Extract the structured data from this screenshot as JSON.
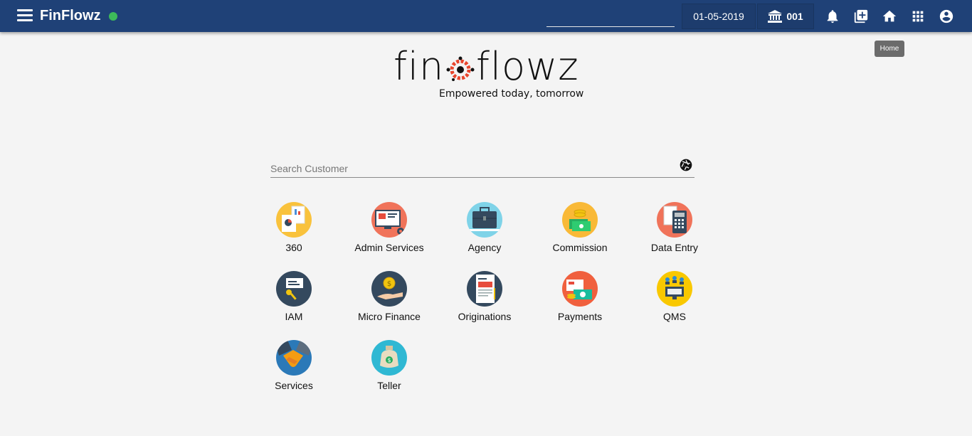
{
  "header": {
    "app_title": "FinFlowz",
    "date": "01-05-2019",
    "branch": "001",
    "search_value": "",
    "tooltip": "Home"
  },
  "logo": {
    "left": "fin",
    "right": "flowz",
    "tagline": "Empowered today, tomorrow"
  },
  "search": {
    "placeholder": "Search Customer"
  },
  "modules": [
    {
      "label": "360",
      "color": "#f9c23c"
    },
    {
      "label": "Admin Services",
      "color": "#f0735a"
    },
    {
      "label": "Agency",
      "color": "#7fd3e8"
    },
    {
      "label": "Commission",
      "color": "#f9b937"
    },
    {
      "label": "Data Entry",
      "color": "#f0735a"
    },
    {
      "label": "IAM",
      "color": "#34495e"
    },
    {
      "label": "Micro Finance",
      "color": "#34495e"
    },
    {
      "label": "Originations",
      "color": "#34495e"
    },
    {
      "label": "Payments",
      "color": "#f0603e"
    },
    {
      "label": "QMS",
      "color": "#f9c800"
    },
    {
      "label": "Services",
      "color": "#2b79b8"
    },
    {
      "label": "Teller",
      "color": "#2fb8d3"
    }
  ],
  "colors": {
    "topbar": "#1f4177",
    "status": "#3dba5a",
    "background": "#f4f4f4"
  }
}
